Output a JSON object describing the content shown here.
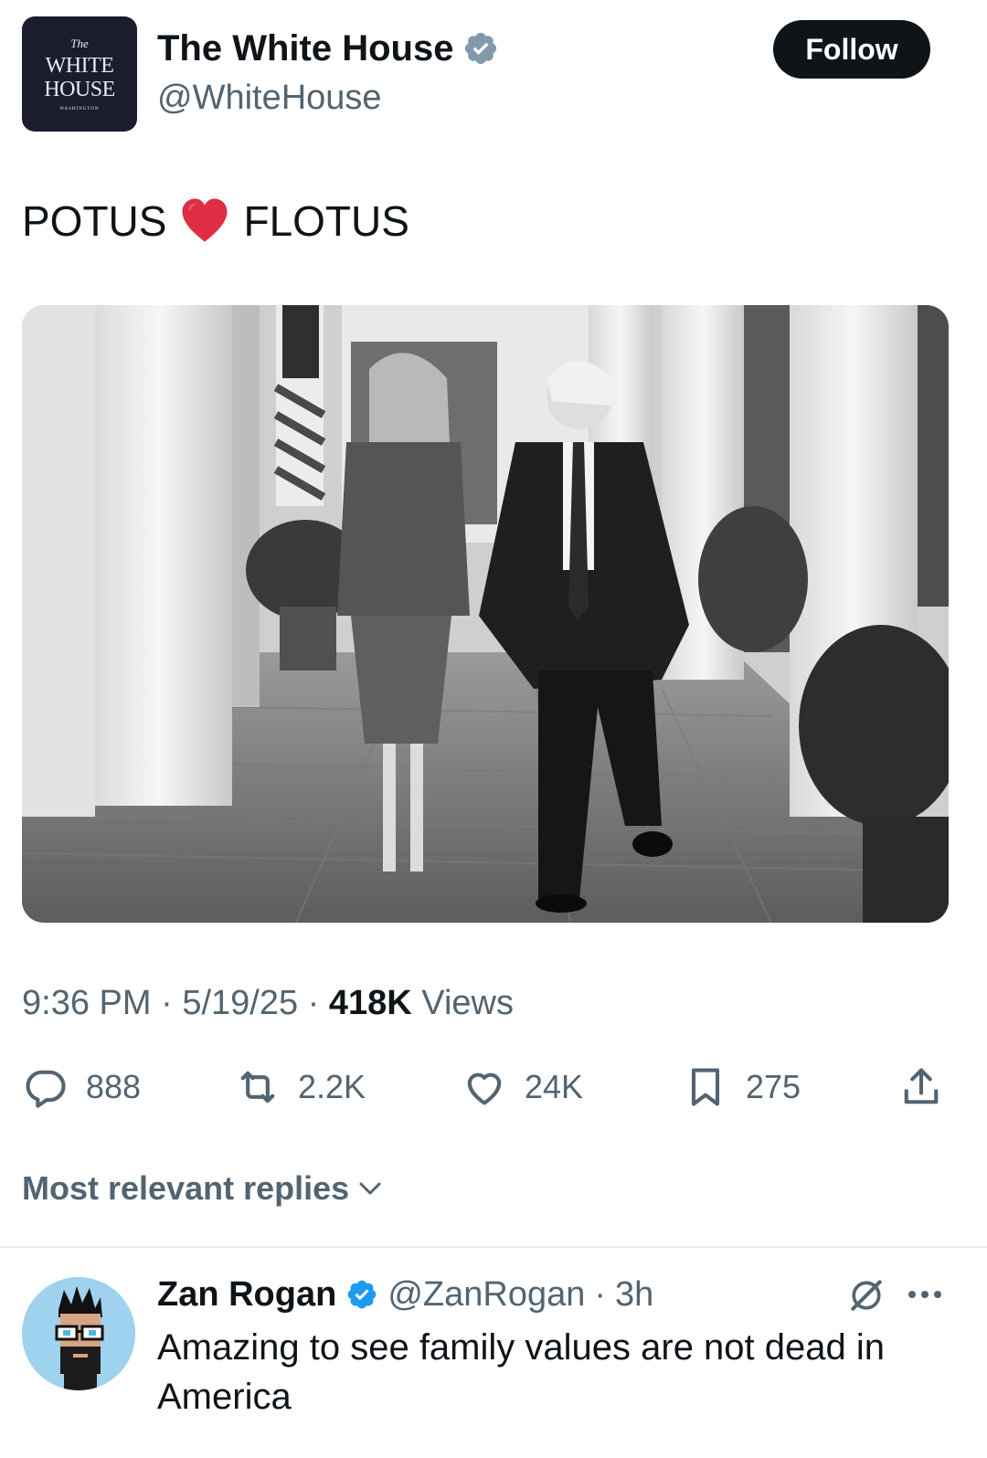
{
  "post": {
    "avatar_logo": {
      "line1": "The",
      "line2": "WHITE",
      "line3": "HOUSE",
      "line4": "WASHINGTON"
    },
    "author_name": "The White House",
    "author_handle": "@WhiteHouse",
    "follow_label": "Follow",
    "text_left": "POTUS",
    "text_emoji": "red-heart-emoji",
    "text_right": "FLOTUS",
    "image_alt": "black-and-white photo of the couple walking hand in hand along a colonnade",
    "time": "9:36 PM",
    "date": "5/19/25",
    "views_count": "418K",
    "views_label": "Views",
    "separator": "·"
  },
  "actions": {
    "replies": {
      "icon": "reply-icon",
      "count": "888"
    },
    "reposts": {
      "icon": "repost-icon",
      "count": "2.2K"
    },
    "likes": {
      "icon": "heart-icon",
      "count": "24K"
    },
    "bookmarks": {
      "icon": "bookmark-icon",
      "count": "275"
    },
    "share": {
      "icon": "share-icon"
    }
  },
  "replies_sort": {
    "label": "Most relevant replies",
    "icon": "chevron-down-icon"
  },
  "reply": {
    "author_name": "Zan Rogan",
    "author_handle": "@ZanRogan",
    "age": "3h",
    "separator": "·",
    "text": "Amazing to see family values are not dead in America",
    "icons": [
      "grok-icon",
      "more-icon"
    ]
  },
  "colors": {
    "text_primary": "#0f1419",
    "text_secondary": "#536471",
    "verified_blue": "#1d9bf0",
    "verified_gray": "#829aab",
    "follow_bg": "#0f1419",
    "avatar_navy": "#1b1d2e"
  }
}
